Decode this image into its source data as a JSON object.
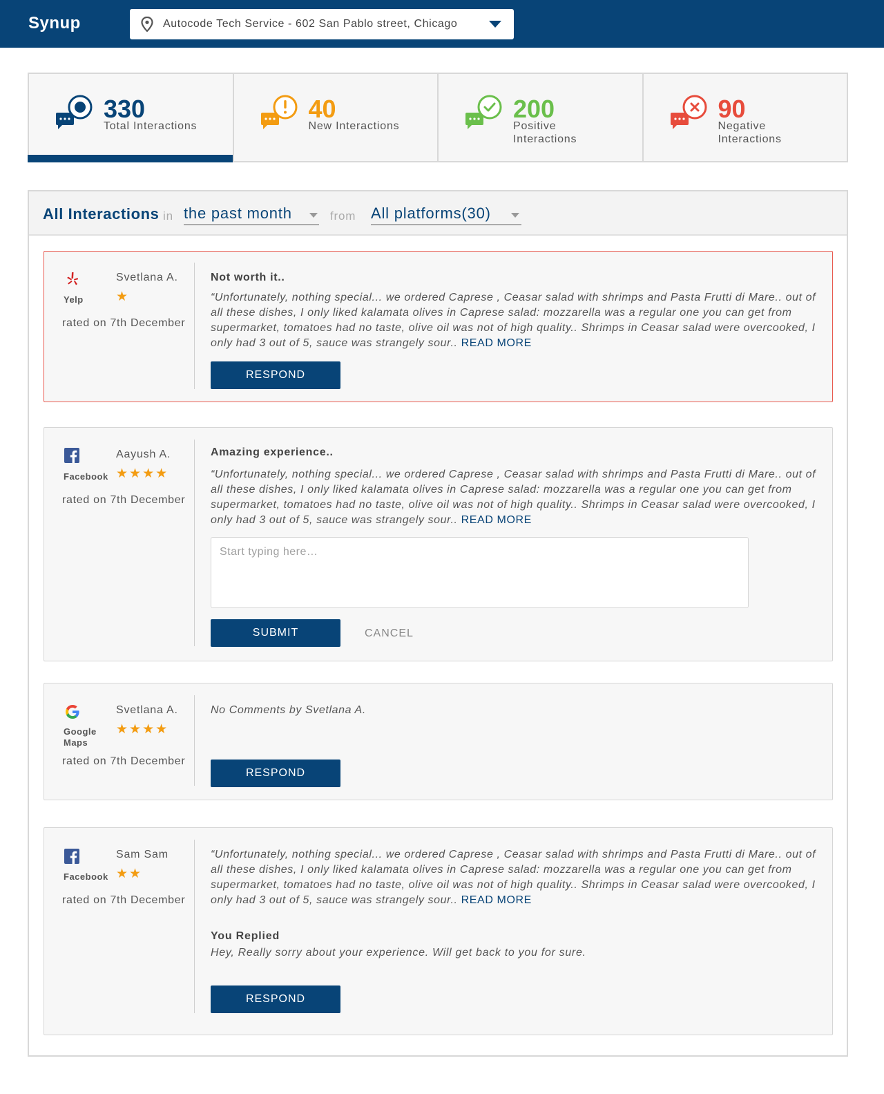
{
  "header": {
    "brand": "Synup",
    "location": "Autocode Tech Service - 602 San Pablo street, Chicago",
    "icons": [
      "location-pin-icon",
      "caret-down-icon"
    ],
    "bg_color": "#084477"
  },
  "stats": [
    {
      "value": "330",
      "label": "Total Interactions",
      "color": "#084477",
      "icon": "chat-dot-icon"
    },
    {
      "value": "40",
      "label": "New Interactions",
      "color": "#f39c12",
      "icon": "chat-exclamation-icon"
    },
    {
      "value": "200",
      "label": "Positive Interactions",
      "color": "#6abf4b",
      "icon": "chat-check-icon"
    },
    {
      "value": "90",
      "label": "Negative Interactions",
      "color": "#e74c3c",
      "icon": "chat-x-icon"
    }
  ],
  "filter": {
    "title": "All Interactions",
    "in_text": "in",
    "period": "the past month",
    "from_text": "from",
    "platform": "All platforms(30)"
  },
  "reviews": [
    {
      "platform": "Yelp",
      "reviewer": "Svetlana A.",
      "stars": "★",
      "rated": "rated on 7th December",
      "title": "Not worth it..",
      "body": "“Unfortunately, nothing special... we ordered Caprese , Ceasar salad with shrimps and Pasta Frutti di Mare.. out of all these dishes, I only liked kalamata olives in Caprese salad: mozzarella was a regular one you can get from supermarket, tomatoes had no taste, olive oil was not of high quality.. Shrimps in Ceasar salad were overcooked, I only had 3 out of 5, sauce was strangely sour..",
      "read_more": "READ MORE",
      "button": "RESPOND"
    },
    {
      "platform": "Facebook",
      "reviewer": "Aayush A.",
      "stars": "★★★★",
      "rated": "rated on 7th December",
      "title": "Amazing experience..",
      "body": "“Unfortunately, nothing special... we ordered Caprese , Ceasar salad with shrimps and Pasta Frutti di Mare.. out of all these dishes, I only liked kalamata olives in Caprese salad: mozzarella was a regular one you can get from supermarket, tomatoes had no taste, olive oil was not of high quality.. Shrimps in Ceasar salad were overcooked, I only had 3 out of 5, sauce was strangely sour..",
      "read_more": "READ MORE",
      "reply_placeholder": "Start typing here…",
      "submit": "SUBMIT",
      "cancel": "CANCEL"
    },
    {
      "platform": "Google Maps",
      "reviewer": "Svetlana A.",
      "stars": "★★★★",
      "rated": "rated on 7th December",
      "body": "No Comments by Svetlana A.",
      "button": "RESPOND"
    },
    {
      "platform": "Facebook",
      "reviewer": "Sam Sam",
      "stars": "★★",
      "rated": "rated on 7th December",
      "body": "“Unfortunately, nothing special... we ordered Caprese , Ceasar salad with shrimps and Pasta Frutti di Mare.. out of all these dishes, I only liked kalamata olives in Caprese salad: mozzarella was a regular one you can get from supermarket, tomatoes had no taste, olive oil was not of high quality.. Shrimps in Ceasar salad were overcooked, I only had 3 out of 5, sauce was strangely sour..",
      "read_more": "READ MORE",
      "replied_title": "You Replied",
      "replied_text": "Hey, Really sorry about your experience. Will get back to you for sure.",
      "button": "RESPOND"
    }
  ]
}
